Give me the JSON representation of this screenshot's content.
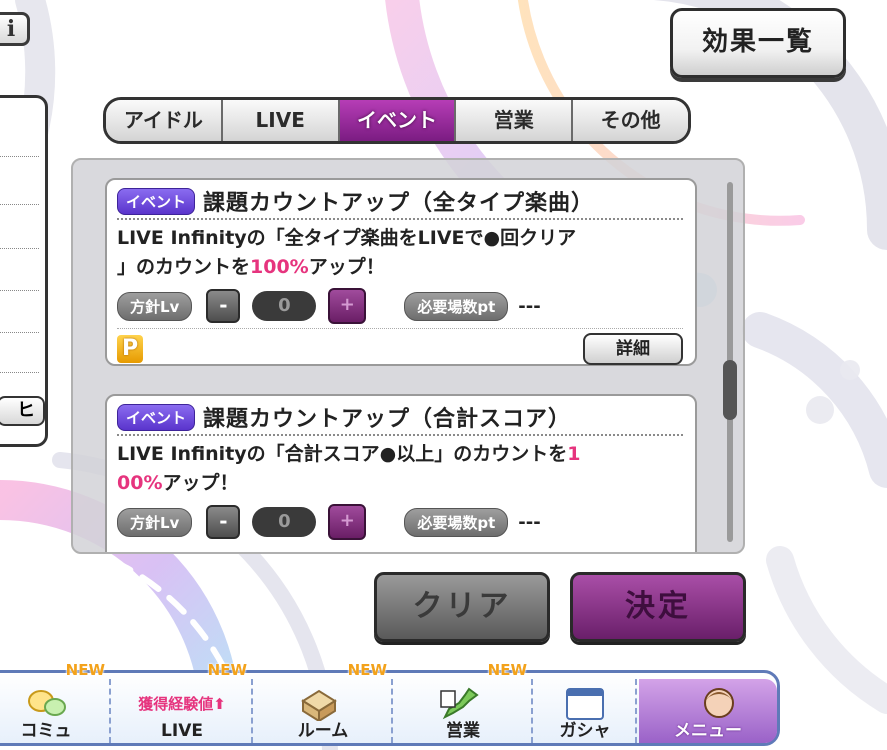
{
  "header": {
    "info_label": "i",
    "effect_list_label": "効果一覧"
  },
  "left_panel": {
    "button_fragment": "ヒ"
  },
  "tabs": [
    {
      "label": "アイドル",
      "active": false
    },
    {
      "label": "LIVE",
      "active": false
    },
    {
      "label": "イベント",
      "active": true
    },
    {
      "label": "営業",
      "active": false
    },
    {
      "label": "その他",
      "active": false
    }
  ],
  "cards": [
    {
      "badge": "イベント",
      "title": "課題カウントアップ（全タイプ楽曲）",
      "desc_line1": "LIVE Infinityの「全タイプ楽曲をLIVEで●回クリア",
      "desc_line2_pre": "」のカウントを",
      "desc_line2_highlight": "100%",
      "desc_line2_post": "アップ！",
      "policy_label": "方針Lv",
      "minus": "-",
      "value": "0",
      "plus": "+",
      "need_label": "必要場数pt",
      "need_value": "---",
      "p_badge": "P",
      "detail_label": "詳細"
    },
    {
      "badge": "イベント",
      "title": "課題カウントアップ（合計スコア）",
      "desc_line1_pre": "LIVE Infinityの「合計スコア●以上」のカウントを",
      "desc_line1_highlight": "1",
      "desc_line2_highlight": "00%",
      "desc_line2_post": "アップ！",
      "policy_label": "方針Lv",
      "minus": "-",
      "value": "0",
      "plus": "+",
      "need_label": "必要場数pt",
      "need_value": "---"
    }
  ],
  "actions": {
    "clear_label": "クリア",
    "decide_label": "決定"
  },
  "nav": {
    "new_tag": "NEW",
    "items": [
      {
        "label": "コミュ",
        "new": true
      },
      {
        "label": "LIVE",
        "sub": "獲得経験値⬆",
        "new": true
      },
      {
        "label": "ルーム",
        "new": true
      },
      {
        "label": "営業",
        "new": true
      },
      {
        "label": "ガシャ",
        "new": false
      },
      {
        "label": "メニュー",
        "new": false
      }
    ]
  },
  "colors": {
    "accent_purple": "#8f2a93",
    "highlight_pink": "#e6347e",
    "event_badge": "#6a44dd",
    "new_tag": "#f3a21b",
    "nav_border": "#5f7ab8"
  }
}
